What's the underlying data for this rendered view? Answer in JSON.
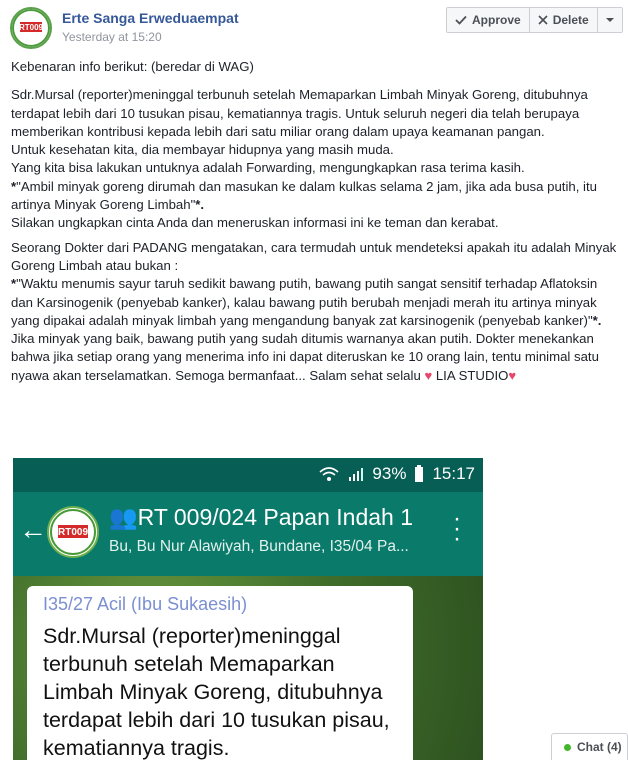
{
  "post": {
    "author": "Erte Sanga Erweduaempat",
    "timestamp": "Yesterday at 15:20",
    "approve_label": "Approve",
    "delete_label": "Delete"
  },
  "body": {
    "p1": "Kebenaran info berikut: (beredar di WAG)",
    "p2a": "Sdr.Mursal (reporter)meninggal terbunuh setelah Memaparkan Limbah Minyak Goreng, ditubuhnya terdapat lebih dari 10 tusukan pisau, kematiannya tragis. Untuk seluruh negeri dia telah berupaya memberikan kontribusi kepada lebih dari satu miliar orang dalam upaya keamanan pangan.",
    "p2b": "Untuk kesehatan kita, dia membayar hidupnya yang masih muda.",
    "p2c": "Yang kita bisa lakukan untuknya adalah Forwarding, mengungkapkan rasa terima kasih.",
    "p2d_star": "*",
    "p2d": "\"Ambil minyak goreng dirumah dan masukan ke dalam kulkas selama 2 jam, jika ada busa putih, itu artinya Minyak Goreng Limbah\"",
    "p2d_end": "*.",
    "p2e": "Silakan ungkapkan cinta Anda dan meneruskan informasi ini ke teman dan kerabat.",
    "p3a": "Seorang Dokter dari PADANG mengatakan, cara termudah untuk mendeteksi apakah itu adalah Minyak Goreng Limbah atau bukan :",
    "p3b_star": "*",
    "p3b": "\"Waktu menumis sayur taruh sedikit bawang putih, bawang putih sangat sensitif terhadap Aflatoksin dan Karsinogenik (penyebab kanker), kalau bawang putih berubah menjadi merah itu artinya minyak yang dipakai adalah minyak limbah yang mengandung banyak zat karsinogenik (penyebab kanker)\"",
    "p3b_end": "*.",
    "p3c": "Jika minyak yang baik, bawang putih yang sudah ditumis warnanya akan putih. Dokter menekankan bahwa jika setiap orang yang menerima info ini dapat diteruskan ke 10 orang lain, tentu minimal satu nyawa akan terselamatkan. Semoga bermanfaat... Salam sehat selalu",
    "p3c_mid": "LIA STUDIO"
  },
  "phone": {
    "battery": "93%",
    "time": "15:17",
    "group_title": "RT 009/024 Papan Indah 1",
    "group_members": "Bu, Bu Nur Alawiyah, Bundane, I35/04 Pa...",
    "avatar_text": "RT009",
    "sender": "I35/27 Acil (Ibu Sukaesih)",
    "message": "Sdr.Mursal (reporter)meninggal terbunuh setelah Memaparkan Limbah Minyak Goreng, ditubuhnya terdapat lebih dari 10 tusukan pisau, kematiannya tragis."
  },
  "chat": {
    "label": "Chat (4)"
  },
  "colors": {
    "link": "#365899",
    "whatsapp_header": "#0a7a6a",
    "heart": "#e8456b",
    "online": "#42b72a"
  },
  "icons": {
    "approve": "checkmark-icon",
    "delete": "close-icon",
    "dropdown": "chevron-down-icon",
    "heart": "heart-icon"
  }
}
